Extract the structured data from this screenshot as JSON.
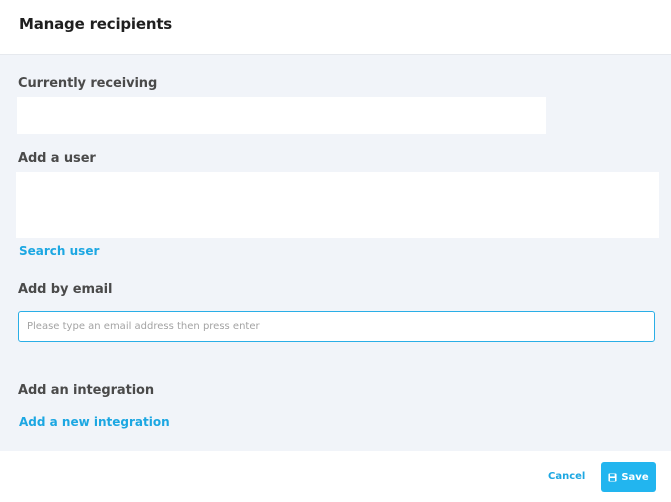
{
  "dialog": {
    "title": "Manage recipients"
  },
  "sections": {
    "currently_receiving_label": "Currently receiving",
    "add_user_label": "Add a user",
    "search_user_link": "Search user",
    "add_by_email_label": "Add by email",
    "email_placeholder": "Please type an email address then press enter",
    "add_integration_label": "Add an integration",
    "add_integration_link": "Add a new integration"
  },
  "footer": {
    "cancel_label": "Cancel",
    "save_label": "Save",
    "save_icon": "floppy-disk-icon"
  },
  "colors": {
    "accent": "#1ca7e2",
    "button": "#22b5ef",
    "panel_bg": "#f1f4f9"
  }
}
